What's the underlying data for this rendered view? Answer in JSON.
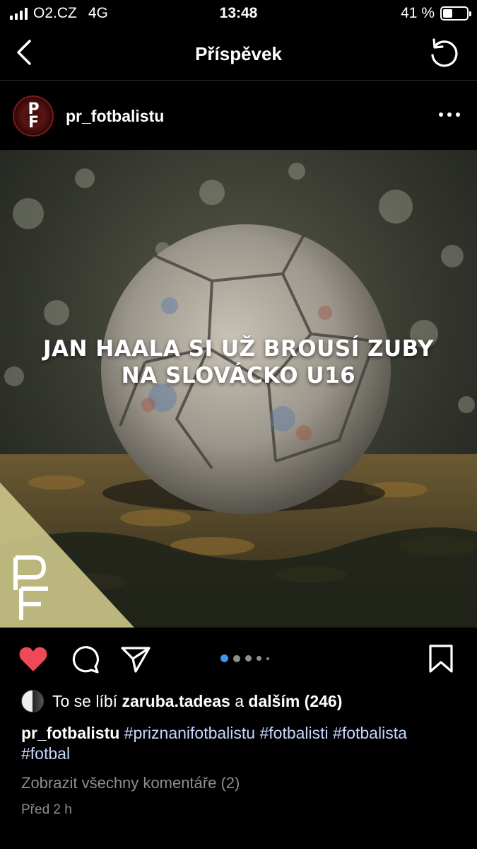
{
  "status_bar": {
    "carrier": "O2.CZ",
    "network": "4G",
    "time": "13:48",
    "battery": "41 %",
    "battery_level": 0.41
  },
  "nav": {
    "title": "Příspěvek",
    "back_icon": "chevron-left-icon",
    "refresh_icon": "refresh-icon"
  },
  "post": {
    "username": "pr_fotbalistu",
    "avatar_text_top": "P",
    "avatar_text_bottom": "F",
    "more_icon": "more-horizontal-icon",
    "image": {
      "headline_line1": "JAN HAALA SI UŽ BROUSÍ ZUBY",
      "headline_line2": "NA SLOVÁCKO U16",
      "watermark_top": "P",
      "watermark_bottom": "F"
    },
    "liked": true,
    "like_color": "#ed4956",
    "carousel": {
      "count": 5,
      "active_index": 0,
      "active_color": "#3897f0"
    },
    "likes": {
      "prefix": "To se líbí",
      "user": "zaruba.tadeas",
      "conjunction": "a",
      "others": "dalším (246)"
    },
    "caption": {
      "username": "pr_fotbalistu",
      "hashtags": [
        "#priznanifotbalistu",
        "#fotbalisti",
        "#fotbalista",
        "#fotbal"
      ]
    },
    "view_comments": "Zobrazit všechny komentáře (2)",
    "posted": "Před 2 h"
  }
}
